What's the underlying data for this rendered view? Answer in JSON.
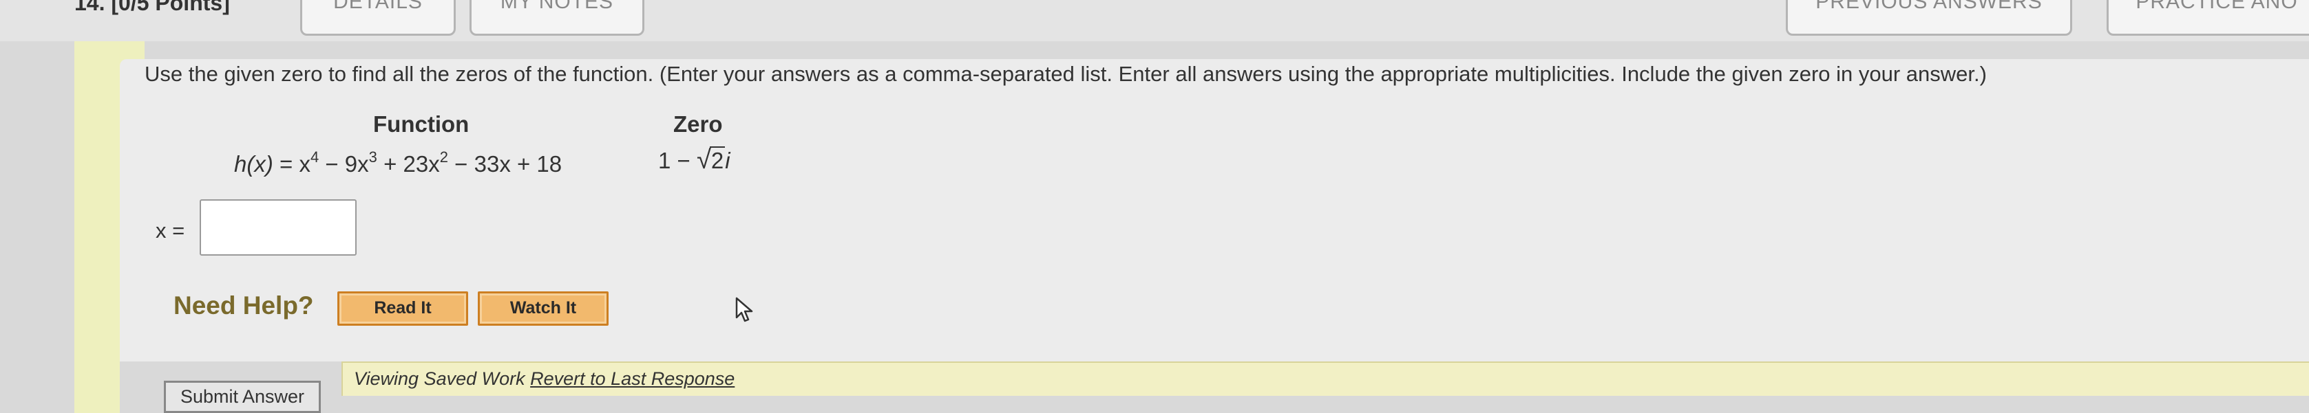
{
  "question": {
    "number_label": "14. [0/5 Points]",
    "tabs": {
      "details": "DETAILS",
      "my_notes": "MY NOTES",
      "previous_answers": "PREVIOUS ANSWERS",
      "practice_another": "PRACTICE ANO"
    }
  },
  "problem": {
    "instructions": "Use the given zero to find all the zeros of the function. (Enter your answers as a comma-separated list. Enter all answers using the appropriate multiplicities. Include the given zero in your answer.)",
    "function_header": "Function",
    "zero_header": "Zero",
    "function_name": "h(x)",
    "function_expr": {
      "eq": " = x",
      "p4": "4",
      "t2": " − 9x",
      "p3": "3",
      "t3": " + 23x",
      "p2": "2",
      "t4": " − 33x + 18"
    },
    "zero": {
      "prefix": "1 − ",
      "radical_sign": "√",
      "radicand": "2",
      "imag_unit": "i"
    }
  },
  "answer": {
    "label": "x =",
    "value": ""
  },
  "help": {
    "label": "Need Help?",
    "read_it": "Read It",
    "watch_it": "Watch It"
  },
  "footer": {
    "submit": "Submit Answer",
    "viewing": "Viewing Saved Work ",
    "revert": "Revert to Last Response"
  },
  "icons": {
    "cursor": "mouse-pointer-icon"
  },
  "colors": {
    "help_button": "#f2b96d",
    "help_border": "#cd7f22",
    "notice_bg": "#f2f0c5",
    "left_band": "#eef0be"
  }
}
